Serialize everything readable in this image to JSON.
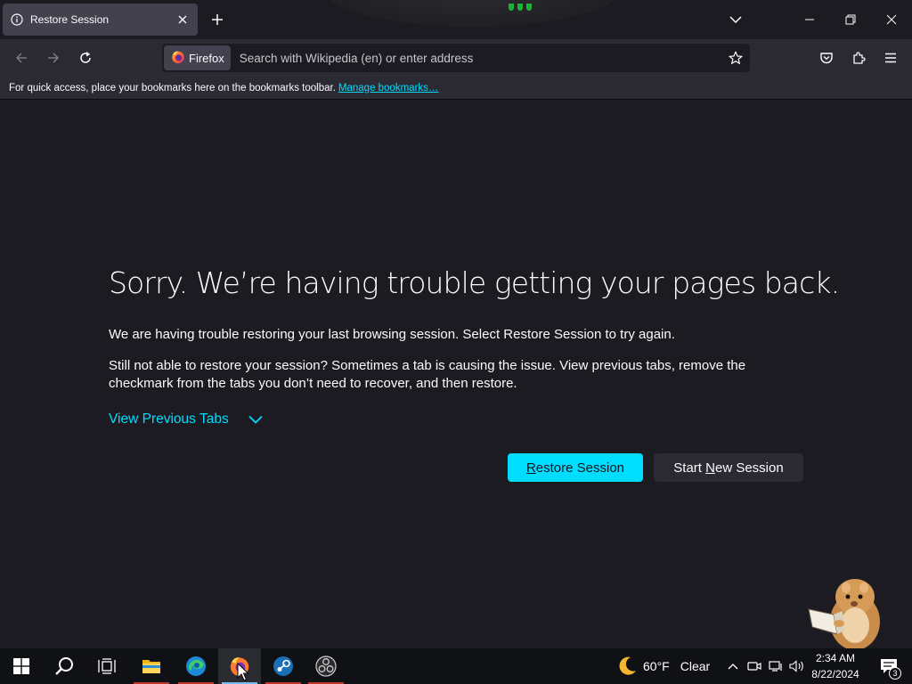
{
  "tab": {
    "title": "Restore Session"
  },
  "navbar": {
    "identity_label": "Firefox",
    "url_placeholder": "Search with Wikipedia (en) or enter address"
  },
  "bookmarks": {
    "message": "For quick access, place your bookmarks here on the bookmarks toolbar.",
    "manage_link": "Manage bookmarks…"
  },
  "content": {
    "headline": "Sorry. We’re having trouble getting your pages back.",
    "paragraph1": "We are having trouble restoring your last browsing session. Select Restore Session to try again.",
    "paragraph2": "Still not able to restore your session? Sometimes a tab is causing the issue. View previous tabs, remove the checkmark from the tabs you don’t need to recover, and then restore.",
    "view_previous_tabs": "View Previous Tabs",
    "restore_button": {
      "accesskey": "R",
      "rest": "estore Session"
    },
    "new_session_button": {
      "before": "Start ",
      "accesskey": "N",
      "after": "ew Session"
    }
  },
  "taskbar": {
    "apps": [
      "start",
      "search",
      "task-view",
      "file-explorer",
      "edge",
      "firefox",
      "steam",
      "obs"
    ],
    "weather": {
      "temp": "60°F",
      "condition": "Clear"
    },
    "clock": {
      "time": "2:34 AM",
      "date": "8/22/2024"
    },
    "notifications_count": "3"
  },
  "colors": {
    "accent": "#00ddff",
    "page_bg": "#1c1b22",
    "toolbar_bg": "#2b2a33",
    "tab_bg": "#42414d",
    "taskbar_bg": "#101114"
  }
}
